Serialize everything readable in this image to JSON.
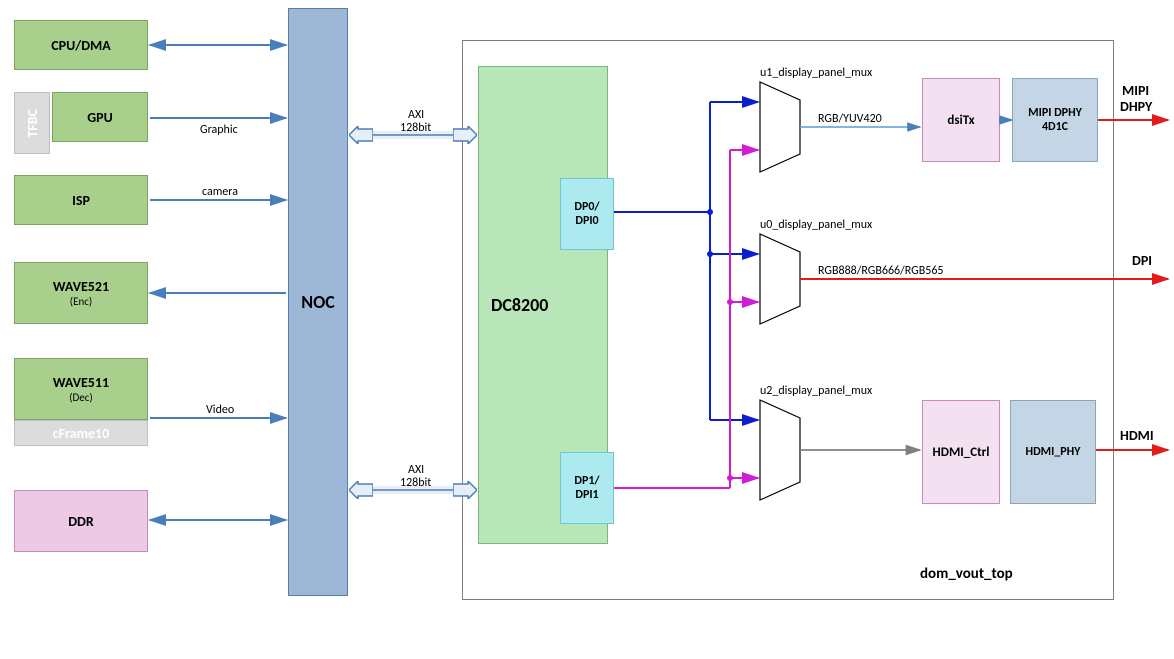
{
  "left": {
    "cpu": "CPU/DMA",
    "gpu": "GPU",
    "tfbc": "TFBC",
    "isp": "ISP",
    "wave521": "WAVE521",
    "wave521_sub": "(Enc)",
    "wave511": "WAVE511",
    "wave511_sub": "(Dec)",
    "cframe10": "cFrame10",
    "ddr": "DDR"
  },
  "noc": "NOC",
  "conn_labels": {
    "graphic": "Graphic",
    "camera": "camera",
    "video": "Video",
    "axi128": "AXI",
    "axi128b": "128bit"
  },
  "dc8200": {
    "title": "DC8200",
    "dp0": "DP0/\nDPI0",
    "dp1": "DP1/\nDPI1"
  },
  "mux": {
    "u1": "u1_display_panel_mux",
    "u0": "u0_display_panel_mux",
    "u2": "u2_display_panel_mux"
  },
  "midlabels": {
    "rgbyuv": "RGB/YUV420",
    "rgb888": "RGB888/RGB666/RGB565"
  },
  "phy": {
    "dsitx": "dsiTx",
    "mipidphy": "MIPI DPHY\n4D1C",
    "hdmictrl": "HDMI_Ctrl",
    "hdmiphy": "HDMI_PHY"
  },
  "outputs": {
    "mipi1": "MIPI",
    "mipi2": "DHPY",
    "dpi": "DPI",
    "hdmi": "HDMI"
  },
  "dom": "dom_vout_top"
}
